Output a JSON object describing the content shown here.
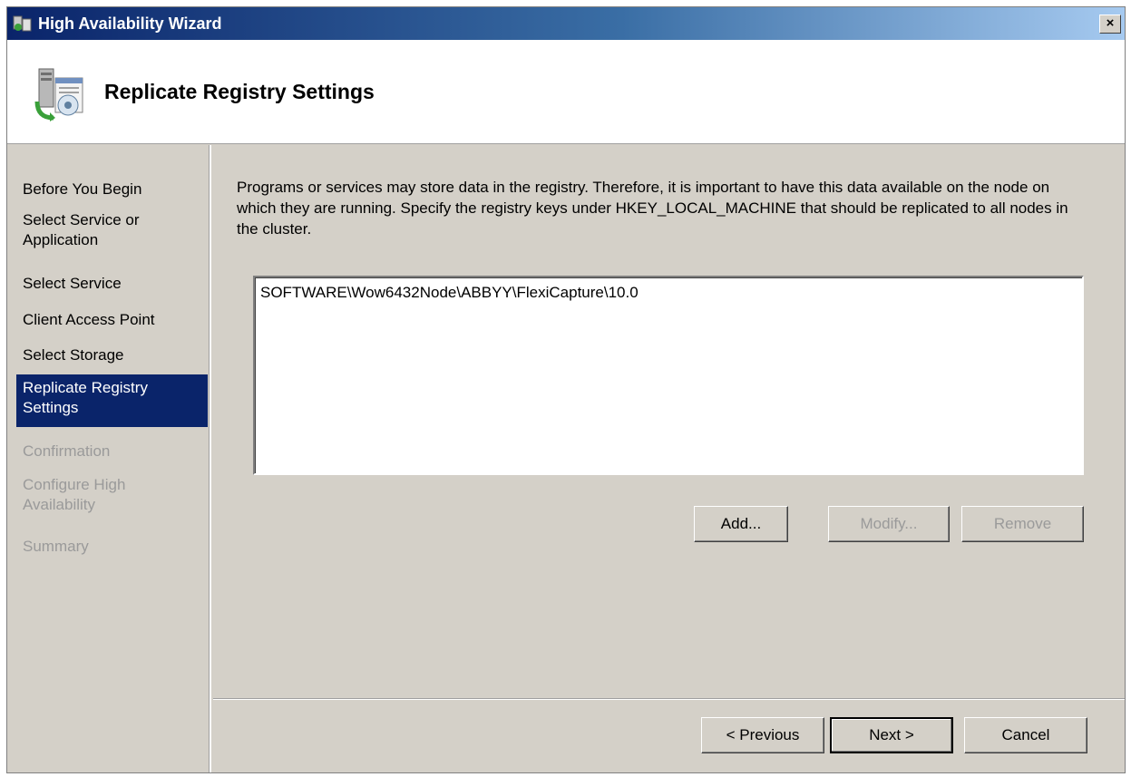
{
  "window": {
    "title": "High Availability Wizard",
    "close_label": "×"
  },
  "header": {
    "title": "Replicate Registry Settings"
  },
  "nav": {
    "items": [
      {
        "label": "Before You Begin",
        "state": "normal"
      },
      {
        "label": "Select Service or Application",
        "state": "normal"
      },
      {
        "label": "Select Service",
        "state": "normal"
      },
      {
        "label": "Client Access Point",
        "state": "normal"
      },
      {
        "label": "Select Storage",
        "state": "normal"
      },
      {
        "label": "Replicate Registry Settings",
        "state": "active"
      },
      {
        "label": "Confirmation",
        "state": "disabled"
      },
      {
        "label": "Configure High Availability",
        "state": "disabled"
      },
      {
        "label": "Summary",
        "state": "disabled"
      }
    ]
  },
  "content": {
    "description": "Programs or services may store data in the registry.  Therefore, it is important to have this data available on the node on which they are running.  Specify the registry keys under HKEY_LOCAL_MACHINE that should be replicated to all nodes in the cluster.",
    "registry_keys": [
      "SOFTWARE\\Wow6432Node\\ABBYY\\FlexiCapture\\10.0"
    ],
    "add_label": "Add...",
    "modify_label": "Modify...",
    "remove_label": "Remove"
  },
  "footer": {
    "previous_label": "< Previous",
    "next_label": "Next >",
    "cancel_label": "Cancel"
  },
  "colors": {
    "titlebar": "#0a246a",
    "selection": "#0a246a",
    "face": "#d4d0c8"
  }
}
